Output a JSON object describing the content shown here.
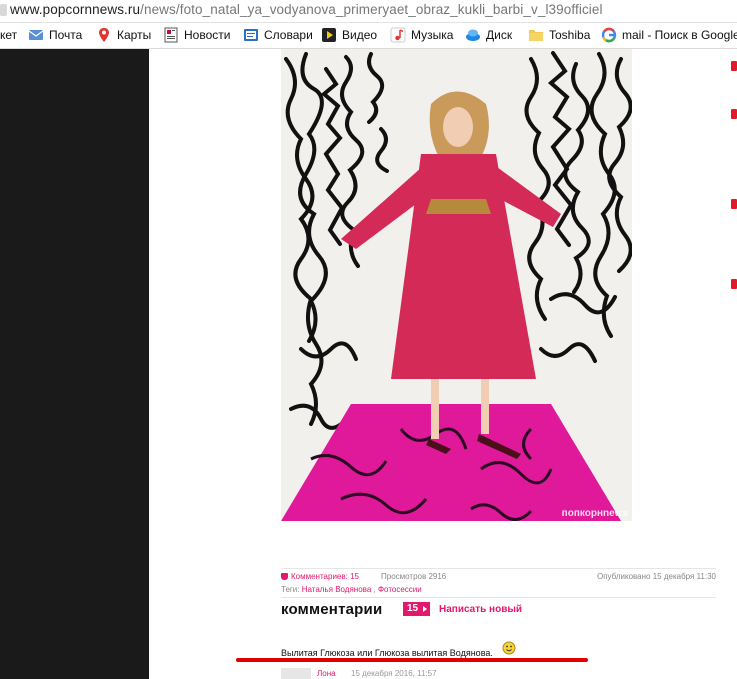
{
  "browser": {
    "url_host": "www.popcornnews.ru",
    "url_path": "/news/foto_natal_ya_vodyanova_primeryaet_obraz_kukli_barbi_v_l39officiel"
  },
  "bookmarks": [
    {
      "label": "кет",
      "icon": "bookmark-partial-icon",
      "color": "#999999"
    },
    {
      "label": "Почта",
      "icon": "mail-icon",
      "color": "#5a8fd6"
    },
    {
      "label": "Карты",
      "icon": "map-pin-icon",
      "color": "#e3342f"
    },
    {
      "label": "Новости",
      "icon": "news-icon",
      "color": "#c8102e"
    },
    {
      "label": "Словари",
      "icon": "dictionary-icon",
      "color": "#2c6fc4"
    },
    {
      "label": "Видео",
      "icon": "video-icon",
      "color": "#333333"
    },
    {
      "label": "Музыка",
      "icon": "music-icon",
      "color": "#e3342f"
    },
    {
      "label": "Диск",
      "icon": "disk-icon",
      "color": "#1e88e5"
    },
    {
      "label": "Toshiba",
      "icon": "folder-icon",
      "color": "#f2c94c"
    },
    {
      "label": "mail - Поиск в Google",
      "icon": "google-icon",
      "color": "#4285f4"
    }
  ],
  "photo": {
    "watermark": "попкорнnews"
  },
  "article": {
    "comments_label": "Комментариев: 15",
    "views_label": "Просмотров 2916",
    "published_label": "Опубликовано 15 декабря 11:30",
    "tags_label": "Теги:",
    "tag_1": "Наталья Водянова",
    "tag_sep": " , ",
    "tag_2": "Фотосессии"
  },
  "comments": {
    "title": "комментарии",
    "count": "15",
    "write_new": "Написать новый",
    "items": [
      {
        "text": "Вылитая Глюкоза или Глюкоза вылитая Водянова.",
        "author": "Лона",
        "date": "15 декабря 2016, 11:57"
      }
    ]
  },
  "colors": {
    "accent": "#e2186c",
    "annotation": "#e00000"
  }
}
